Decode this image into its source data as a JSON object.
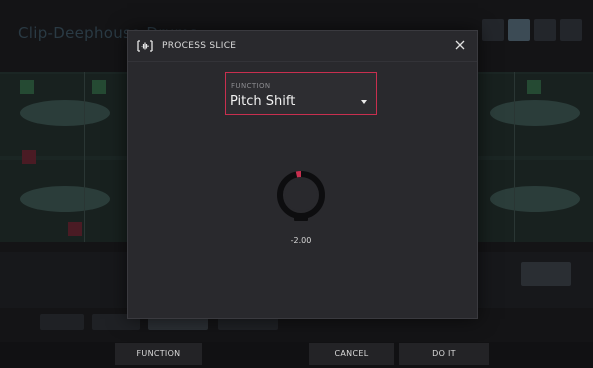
{
  "background": {
    "title": "Clip-Deephouse-Drums"
  },
  "dialog": {
    "title": "PROCESS SLICE",
    "icon": "waveform-process-icon",
    "close_icon": "close-icon",
    "function_field": {
      "label": "FUNCTION",
      "value": "Pitch Shift"
    },
    "knob": {
      "value": -2.0,
      "display": "-2.00"
    }
  },
  "softkeys": {
    "function": "FUNCTION",
    "cancel": "CANCEL",
    "do_it": "DO IT"
  },
  "colors": {
    "accent": "#c82f4f",
    "dialog_bg": "#29292d",
    "softkey_bg": "#232326"
  }
}
